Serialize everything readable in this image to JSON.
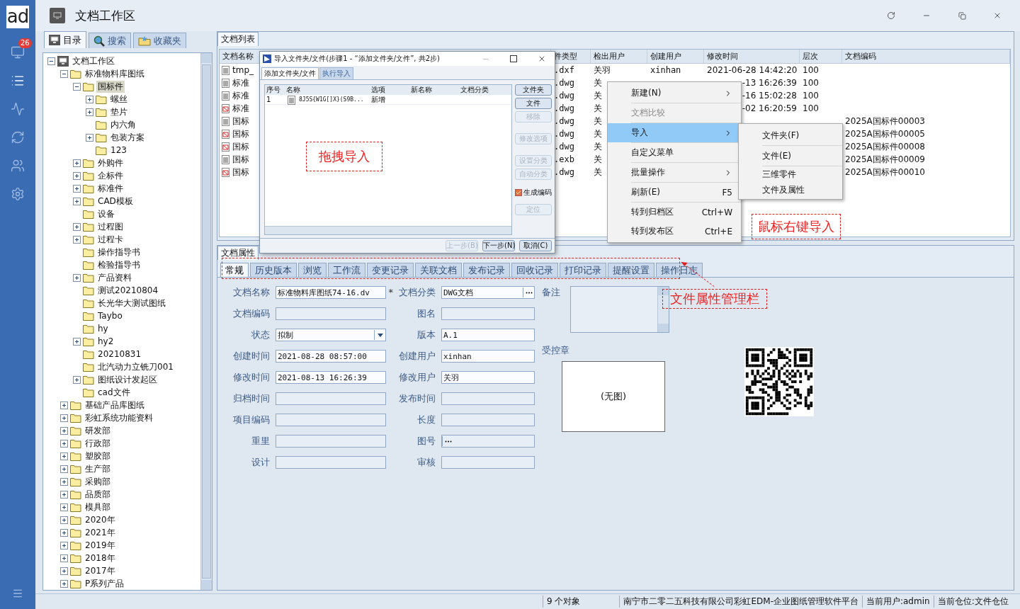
{
  "sidebar": {
    "logo": "ad",
    "items": [
      {
        "kind": "monitor",
        "badge": "26",
        "selected": false
      },
      {
        "kind": "list",
        "selected": true
      },
      {
        "kind": "chart",
        "selected": false
      },
      {
        "kind": "sync",
        "selected": false
      },
      {
        "kind": "users",
        "selected": false
      },
      {
        "kind": "settings",
        "selected": false
      }
    ]
  },
  "window": {
    "title": "文档工作区"
  },
  "left_tabs": [
    {
      "label": "目录",
      "kind": "computer",
      "selected": true
    },
    {
      "label": "搜索",
      "kind": "search",
      "selected": false
    },
    {
      "label": "收藏夹",
      "kind": "favorites",
      "selected": false
    }
  ],
  "tree": {
    "nodes": [
      {
        "label": "文档工作区",
        "kind": "computer",
        "expanded": true,
        "selected": false,
        "children": [
          {
            "label": "标准物料库图纸",
            "expanded": true,
            "selected": false,
            "children": [
              {
                "label": "国标件",
                "expanded": true,
                "selected": true,
                "children": [
                  {
                    "label": "螺丝",
                    "expanded": false,
                    "selected": false
                  },
                  {
                    "label": "垫片",
                    "expanded": false,
                    "selected": false
                  },
                  {
                    "label": "内六角",
                    "selected": false
                  },
                  {
                    "label": "包装方案",
                    "expanded": false,
                    "selected": false
                  },
                  {
                    "label": "123",
                    "selected": false
                  }
                ]
              },
              {
                "label": "外购件",
                "expanded": false,
                "selected": false
              },
              {
                "label": "企标件",
                "expanded": false,
                "selected": false
              },
              {
                "label": "标准件",
                "expanded": false,
                "selected": false
              },
              {
                "label": "CAD模板",
                "expanded": false,
                "selected": false
              },
              {
                "label": "设备",
                "selected": false
              },
              {
                "label": "过程图",
                "expanded": false,
                "selected": false
              },
              {
                "label": "过程卡",
                "expanded": false,
                "selected": false
              },
              {
                "label": "操作指导书",
                "selected": false
              },
              {
                "label": "检验指导书",
                "selected": false
              },
              {
                "label": "产品资料",
                "expanded": false,
                "selected": false
              },
              {
                "label": "测试20210804",
                "selected": false
              },
              {
                "label": "长光华大测试图纸",
                "selected": false
              },
              {
                "label": "Taybo",
                "selected": false
              },
              {
                "label": "hy",
                "selected": false
              },
              {
                "label": "hy2",
                "expanded": false,
                "selected": false
              },
              {
                "label": "20210831",
                "selected": false
              },
              {
                "label": "北汽动力立铣刀001",
                "selected": false
              },
              {
                "label": "图纸设计发起区",
                "expanded": false,
                "selected": false
              },
              {
                "label": "cad文件",
                "selected": false
              }
            ]
          },
          {
            "label": "基础产品库图纸",
            "expanded": false,
            "selected": false
          },
          {
            "label": "彩虹系统功能资料",
            "expanded": false,
            "selected": false
          },
          {
            "label": "研发部",
            "expanded": false,
            "selected": false
          },
          {
            "label": "行政部",
            "expanded": false,
            "selected": false
          },
          {
            "label": "塑胶部",
            "expanded": false,
            "selected": false
          },
          {
            "label": "生产部",
            "expanded": false,
            "selected": false
          },
          {
            "label": "采购部",
            "expanded": false,
            "selected": false
          },
          {
            "label": "品质部",
            "expanded": false,
            "selected": false
          },
          {
            "label": "模具部",
            "expanded": false,
            "selected": false
          },
          {
            "label": "2020年",
            "expanded": false,
            "selected": false
          },
          {
            "label": "2021年",
            "expanded": false,
            "selected": false
          },
          {
            "label": "2019年",
            "expanded": false,
            "selected": false
          },
          {
            "label": "2018年",
            "expanded": false,
            "selected": false
          },
          {
            "label": "2017年",
            "expanded": false,
            "selected": false
          },
          {
            "label": "P系列产品",
            "expanded": false,
            "selected": false
          }
        ]
      }
    ]
  },
  "doc_list": {
    "title": "文档列表",
    "columns": [
      "文档名称",
      "件类型",
      "检出用户",
      "创建用户",
      "修改时间",
      "层次",
      "文档编码"
    ],
    "rows": [
      {
        "kind": "plain",
        "name": "tmp_",
        "type": ".dxf",
        "checkout": "关羽",
        "creator": "xinhan",
        "modified": "2021-06-28 14:42:20",
        "layer": "100"
      },
      {
        "kind": "plain",
        "name": "标准",
        "type": ".dwg",
        "checkout": "关",
        "modified": "-13 16:26:39",
        "layer": "100"
      },
      {
        "kind": "plain",
        "name": "标准",
        "type": ".dwg",
        "checkout": "关",
        "modified": "-16 15:02:28",
        "layer": "100"
      },
      {
        "kind": "drawing",
        "name": "标准",
        "type": ".dwg",
        "checkout": "关",
        "modified": "-02 16:20:59",
        "layer": "100"
      },
      {
        "kind": "plain",
        "name": "国标",
        "type": ".dwg",
        "checkout": "关",
        "code": "2025A国标件00003"
      },
      {
        "kind": "drawing",
        "name": "国标",
        "type": ".dwg",
        "checkout": "关",
        "code": "2025A国标件00005"
      },
      {
        "kind": "drawing",
        "name": "国标",
        "type": ".dwg",
        "checkout": "关",
        "code": "2025A国标件00008"
      },
      {
        "kind": "plain",
        "name": "国标",
        "type": ".exb",
        "checkout": "关",
        "code": "2025A国标件00009"
      },
      {
        "kind": "drawing",
        "name": "国标",
        "type": ".dwg",
        "checkout": "关",
        "code": "2025A国标件00010"
      }
    ]
  },
  "properties": {
    "title": "文档属性",
    "tabs": [
      {
        "label": "常规",
        "selected": true
      },
      {
        "label": "历史版本",
        "selected": false
      },
      {
        "label": "浏览",
        "selected": false
      },
      {
        "label": "工作流",
        "selected": false
      },
      {
        "label": "变更记录",
        "selected": false
      },
      {
        "label": "关联文档",
        "selected": false
      },
      {
        "label": "发布记录",
        "selected": false
      },
      {
        "label": "回收记录",
        "selected": false
      },
      {
        "label": "打印记录",
        "selected": false
      },
      {
        "label": "提醒设置",
        "selected": false
      },
      {
        "label": "操作日志",
        "selected": false
      }
    ],
    "fields": [
      {
        "label": "文档名称",
        "kind": "text",
        "value": "标准物料库图纸74-16.dv",
        "marker": "*"
      },
      {
        "label": "文档分类",
        "kind": "picker",
        "value": "DWG文档"
      },
      {
        "label": "文档编码",
        "kind": "text"
      },
      {
        "label": "图名",
        "kind": "text"
      },
      {
        "label": "状态",
        "kind": "select",
        "value": "拟制"
      },
      {
        "label": "版本",
        "kind": "text",
        "value": "A.1"
      },
      {
        "label": "创建时间",
        "kind": "text",
        "value": "2021-08-28 08:57:00"
      },
      {
        "label": "创建用户",
        "kind": "text",
        "value": "xinhan"
      },
      {
        "label": "修改时间",
        "kind": "text",
        "value": "2021-08-13 16:26:39"
      },
      {
        "label": "修改用户",
        "kind": "text",
        "value": "关羽"
      },
      {
        "label": "归档时间",
        "kind": "text"
      },
      {
        "label": "发布时间",
        "kind": "text"
      },
      {
        "label": "项目编码",
        "kind": "text"
      },
      {
        "label": "长度",
        "kind": "text"
      },
      {
        "label": "重里",
        "kind": "text"
      },
      {
        "label": "图号",
        "kind": "picker"
      },
      {
        "label": "设计",
        "kind": "text"
      },
      {
        "label": "审核",
        "kind": "text"
      }
    ],
    "notes_label": "备注",
    "stamp_label": "受控章",
    "stamp_text": "(无图)"
  },
  "dialog": {
    "title": "导入文件夹/文件(步骤1 - “添加文件夹/文件”, 共2步)",
    "tabs": [
      {
        "label": "添加文件夹/文件",
        "selected": true
      },
      {
        "label": "执行导入",
        "selected": false
      }
    ],
    "columns": [
      "序号",
      "名称",
      "选项",
      "新名称",
      "文档分类"
    ],
    "rows": [
      {
        "index": "1",
        "name": "8J5S{W1G[]X}(S9B...",
        "option": "新增"
      }
    ],
    "side_controls": [
      {
        "kind": "button",
        "label": "文件夹",
        "disabled": false
      },
      {
        "kind": "button",
        "label": "文件",
        "disabled": false
      },
      {
        "kind": "button",
        "label": "移除",
        "disabled": true
      },
      {
        "kind": "button",
        "label": "修改选项",
        "disabled": true
      },
      {
        "kind": "button",
        "label": "设置分类",
        "disabled": true
      },
      {
        "kind": "button",
        "label": "自动分类",
        "disabled": true
      },
      {
        "kind": "checkbox",
        "label": "生成编码",
        "checked": true
      },
      {
        "kind": "button",
        "label": "定位",
        "disabled": true
      }
    ],
    "footer_buttons": [
      {
        "label": "上一步(B)",
        "disabled": true
      },
      {
        "label": "下一步(N)",
        "disabled": false
      },
      {
        "label": "取消(C)",
        "disabled": false
      }
    ]
  },
  "context_menu": {
    "items": [
      {
        "label": "新建(N)",
        "kind": "submenu",
        "disabled": false,
        "selected": false,
        "separator_after": true
      },
      {
        "label": "文档比较",
        "kind": "plain",
        "disabled": true,
        "selected": false,
        "separator_after": true
      },
      {
        "label": "导入",
        "kind": "submenu",
        "disabled": false,
        "selected": true,
        "separator_after": true
      },
      {
        "label": "自定义菜单",
        "kind": "plain",
        "disabled": false,
        "selected": false,
        "separator_after": true
      },
      {
        "label": "批量操作",
        "kind": "submenu",
        "disabled": false,
        "selected": false,
        "separator_after": true
      },
      {
        "label": "刷新(E)",
        "kind": "shortcut",
        "shortcut": "F5",
        "disabled": false,
        "selected": false,
        "separator_after": true
      },
      {
        "label": "转到归档区",
        "kind": "shortcut",
        "shortcut": "Ctrl+W",
        "disabled": false,
        "selected": false,
        "separator_after": false
      },
      {
        "label": "转到发布区",
        "kind": "shortcut",
        "shortcut": "Ctrl+E",
        "disabled": false,
        "selected": false,
        "separator_after": false
      }
    ],
    "submenu": [
      {
        "label": "文件夹(F)",
        "separator_after": true
      },
      {
        "label": "文件(E)",
        "separator_after": true
      },
      {
        "label": "三维零件",
        "separator_after": false
      },
      {
        "label": "文件及属性",
        "separator_after": false
      }
    ]
  },
  "annotations": [
    {
      "kind": "drag",
      "text": "拖拽导入"
    },
    {
      "kind": "menu",
      "text": "鼠标右键导入"
    },
    {
      "kind": "tabs",
      "text": "文件属性管理栏"
    }
  ],
  "status_bar": {
    "count": "9 个对象",
    "company": "南宁市二零二五科技有限公司彩虹EDM-企业图纸管理软件平台",
    "user": "当前用户:admin",
    "location": "当前仓位:文件仓位"
  }
}
